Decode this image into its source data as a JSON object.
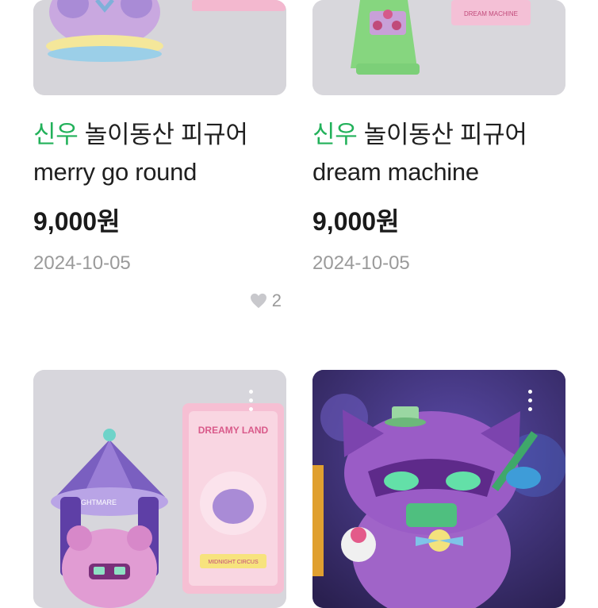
{
  "products": [
    {
      "title_highlight": "신우",
      "title_rest": " 놀이동산 피규어",
      "title_line2": "merry go round",
      "price": "9,000원",
      "date": "2024-10-05",
      "likes": "2",
      "icon": "heart-icon"
    },
    {
      "title_highlight": "신우",
      "title_rest": " 놀이동산 피규어",
      "title_line2": "dream machine",
      "price": "9,000원",
      "date": "2024-10-05",
      "card_label": "DREAM MACHINE"
    },
    {
      "card_label_top": "DREAMY LAND",
      "tent_label": "NIGHTMARE",
      "card_label_bottom": "MIDNIGHT CIRCUS"
    },
    {}
  ],
  "colors": {
    "accent": "#22b15a",
    "price": "#1a1a1a",
    "meta": "#9a9a9a"
  }
}
